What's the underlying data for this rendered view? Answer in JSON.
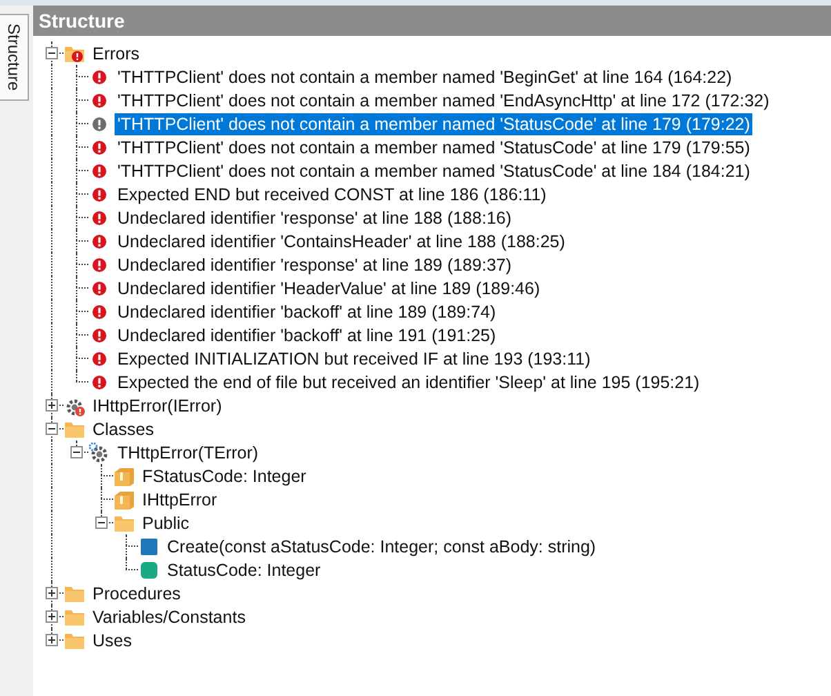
{
  "panel": {
    "tab": "Structure",
    "title": "Structure"
  },
  "tree": [
    {
      "label": "Errors",
      "kind": "error-folder",
      "expanded": true,
      "selected": false,
      "children": [
        {
          "label": "'THTTPClient' does not contain a member named 'BeginGet' at line 164 (164:22)",
          "kind": "error",
          "selected": false
        },
        {
          "label": "'THTTPClient' does not contain a member named 'EndAsyncHttp' at line 172 (172:32)",
          "kind": "error",
          "selected": false
        },
        {
          "label": "'THTTPClient' does not contain a member named 'StatusCode' at line 179 (179:22)",
          "kind": "error",
          "selected": true
        },
        {
          "label": "'THTTPClient' does not contain a member named 'StatusCode' at line 179 (179:55)",
          "kind": "error",
          "selected": false
        },
        {
          "label": "'THTTPClient' does not contain a member named 'StatusCode' at line 184 (184:21)",
          "kind": "error",
          "selected": false
        },
        {
          "label": "Expected END but received CONST at line 186 (186:11)",
          "kind": "error",
          "selected": false
        },
        {
          "label": "Undeclared identifier 'response' at line 188 (188:16)",
          "kind": "error",
          "selected": false
        },
        {
          "label": "Undeclared identifier 'ContainsHeader' at line 188 (188:25)",
          "kind": "error",
          "selected": false
        },
        {
          "label": "Undeclared identifier 'response' at line 189 (189:37)",
          "kind": "error",
          "selected": false
        },
        {
          "label": "Undeclared identifier 'HeaderValue' at line 189 (189:46)",
          "kind": "error",
          "selected": false
        },
        {
          "label": "Undeclared identifier 'backoff' at line 189 (189:74)",
          "kind": "error",
          "selected": false
        },
        {
          "label": "Undeclared identifier 'backoff' at line 191 (191:25)",
          "kind": "error",
          "selected": false
        },
        {
          "label": "Expected INITIALIZATION but received IF at line 193 (193:11)",
          "kind": "error",
          "selected": false
        },
        {
          "label": "Expected the end of file but received an identifier 'Sleep' at line 195 (195:21)",
          "kind": "error",
          "selected": false
        }
      ]
    },
    {
      "label": "IHttpError(IError)",
      "kind": "interface",
      "expanded": false,
      "selected": false
    },
    {
      "label": "Classes",
      "kind": "folder",
      "expanded": true,
      "selected": false,
      "children": [
        {
          "label": "THttpError(TError)",
          "kind": "class",
          "expanded": true,
          "selected": false,
          "children": [
            {
              "label": "FStatusCode: Integer",
              "kind": "field",
              "selected": false
            },
            {
              "label": "IHttpError",
              "kind": "field",
              "selected": false
            },
            {
              "label": "Public",
              "kind": "folder",
              "expanded": true,
              "selected": false,
              "children": [
                {
                  "label": "Create(const aStatusCode: Integer; const aBody: string)",
                  "kind": "method",
                  "selected": false
                },
                {
                  "label": "StatusCode: Integer",
                  "kind": "property",
                  "selected": false
                }
              ]
            }
          ]
        }
      ]
    },
    {
      "label": "Procedures",
      "kind": "folder",
      "expanded": false,
      "selected": false
    },
    {
      "label": "Variables/Constants",
      "kind": "folder",
      "expanded": false,
      "selected": false
    },
    {
      "label": "Uses",
      "kind": "folder",
      "expanded": false,
      "selected": false
    }
  ]
}
